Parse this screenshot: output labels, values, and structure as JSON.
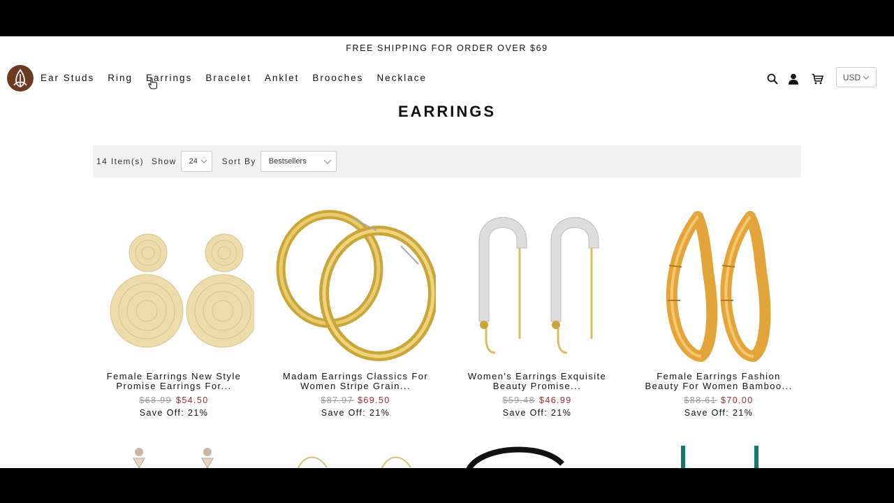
{
  "announcement": "FREE SHIPPING FOR ORDER OVER $69",
  "nav": [
    "Ear Studs",
    "Ring",
    "Earrings",
    "Bracelet",
    "Anklet",
    "Brooches",
    "Necklace"
  ],
  "header": {
    "currency": "USD"
  },
  "page_title": "EARRINGS",
  "toolbar": {
    "item_count": "14 Item(s)",
    "show_label": "Show",
    "show_value": "24",
    "sort_label": "Sort By",
    "sort_value": "Bestsellers"
  },
  "products": [
    {
      "name_line1": "Female Earrings New Style",
      "name_line2": "Promise Earrings For...",
      "old_price": "$68.99",
      "new_price": "$54.50",
      "save": "Save Off: 21%"
    },
    {
      "name_line1": "Madam Earrings Classics For",
      "name_line2": "Women Stripe Grain...",
      "old_price": "$87.97",
      "new_price": "$69.50",
      "save": "Save Off: 21%"
    },
    {
      "name_line1": "Women's Earrings Exquisite",
      "name_line2": "Beauty Promise...",
      "old_price": "$59.48",
      "new_price": "$46.99",
      "save": "Save Off: 21%"
    },
    {
      "name_line1": "Female Earrings Fashion",
      "name_line2": "Beauty For Women Bamboo...",
      "old_price": "$88.61",
      "new_price": "$70.00",
      "save": "Save Off: 21%"
    }
  ],
  "icons": {
    "search": "search-icon",
    "account": "user-icon",
    "cart": "cart-icon",
    "chevron": "chevron-down-icon"
  },
  "colors": {
    "sale_price": "#b22222",
    "logo_bg": "#6b3a20"
  }
}
